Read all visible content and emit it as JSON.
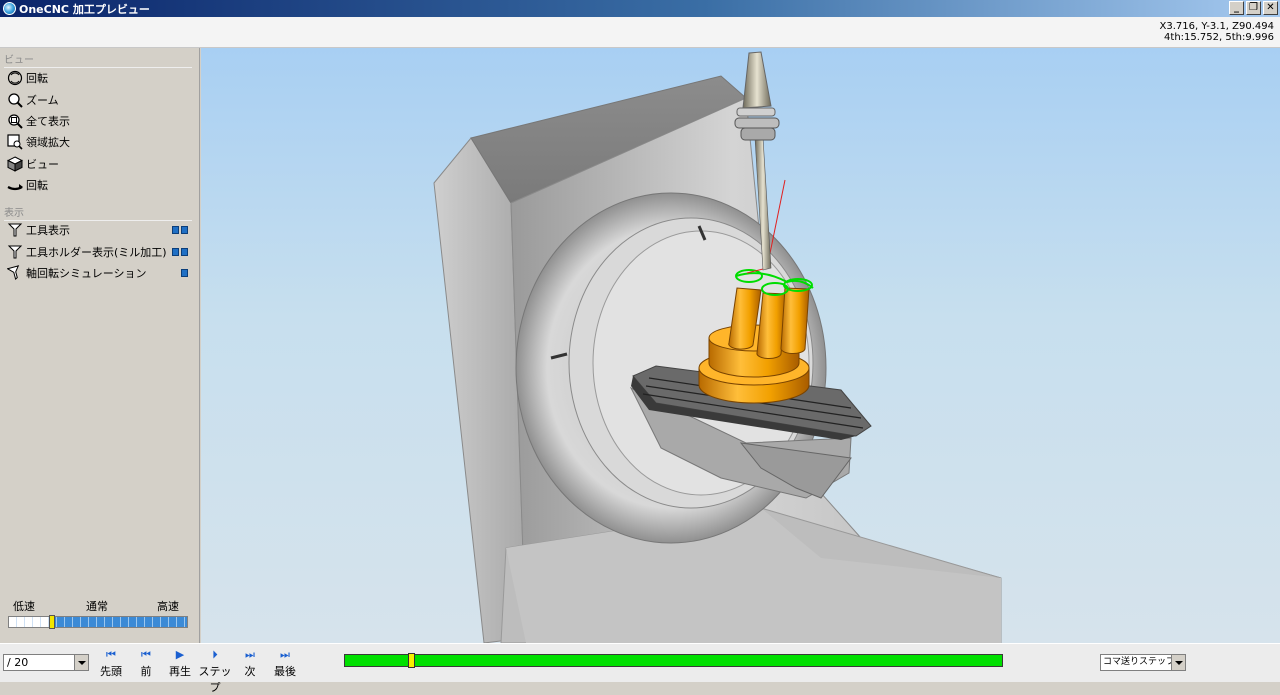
{
  "window": {
    "title": "OneCNC 加工プレビュー",
    "buttons": [
      "_",
      "❐",
      "✕"
    ]
  },
  "coords": {
    "line1": "X3.716, Y-3.1, Z90.494",
    "line2": "4th:15.752, 5th:9.996"
  },
  "panel": {
    "view_section": "ビュー",
    "view_items": [
      {
        "label": "回転",
        "icon": "rotate-icon"
      },
      {
        "label": "ズーム",
        "icon": "zoom-icon"
      },
      {
        "label": "全て表示",
        "icon": "zoom-all-icon"
      },
      {
        "label": "領域拡大",
        "icon": "zoom-window-icon"
      },
      {
        "label": "ビュー",
        "icon": "cube-view-icon"
      },
      {
        "label": "回転",
        "icon": "rotate-arrow-icon"
      }
    ],
    "display_section": "表示",
    "display_items": [
      {
        "label": "工具表示",
        "icon": "tool-icon",
        "toggles": 2
      },
      {
        "label": "工具ホルダー表示(ミル加工)",
        "icon": "tool-holder-icon",
        "toggles": 2
      },
      {
        "label": "軸回転シミュレーション",
        "icon": "axis-rotation-icon",
        "toggles": 1
      }
    ],
    "speed": {
      "slow": "低速",
      "normal": "通常",
      "fast": "高速",
      "position": 0.24
    }
  },
  "toolbar": {
    "page_value": "/ 20",
    "buttons": [
      {
        "label": "先頭",
        "glyph": "⏮"
      },
      {
        "label": "前",
        "glyph": "⏮"
      },
      {
        "label": "再生",
        "glyph": "▶"
      },
      {
        "label": "ステップ",
        "glyph": "⏵"
      },
      {
        "label": "次",
        "glyph": "⏭"
      },
      {
        "label": "最後",
        "glyph": "⏭"
      }
    ],
    "progress": 0.1,
    "mode_value": "コマ送りステップ数"
  },
  "colors": {
    "progress": "#00e000",
    "part": "#f0a000",
    "part_toolpath": "#00dd00",
    "machine": "#c8c8c8"
  }
}
